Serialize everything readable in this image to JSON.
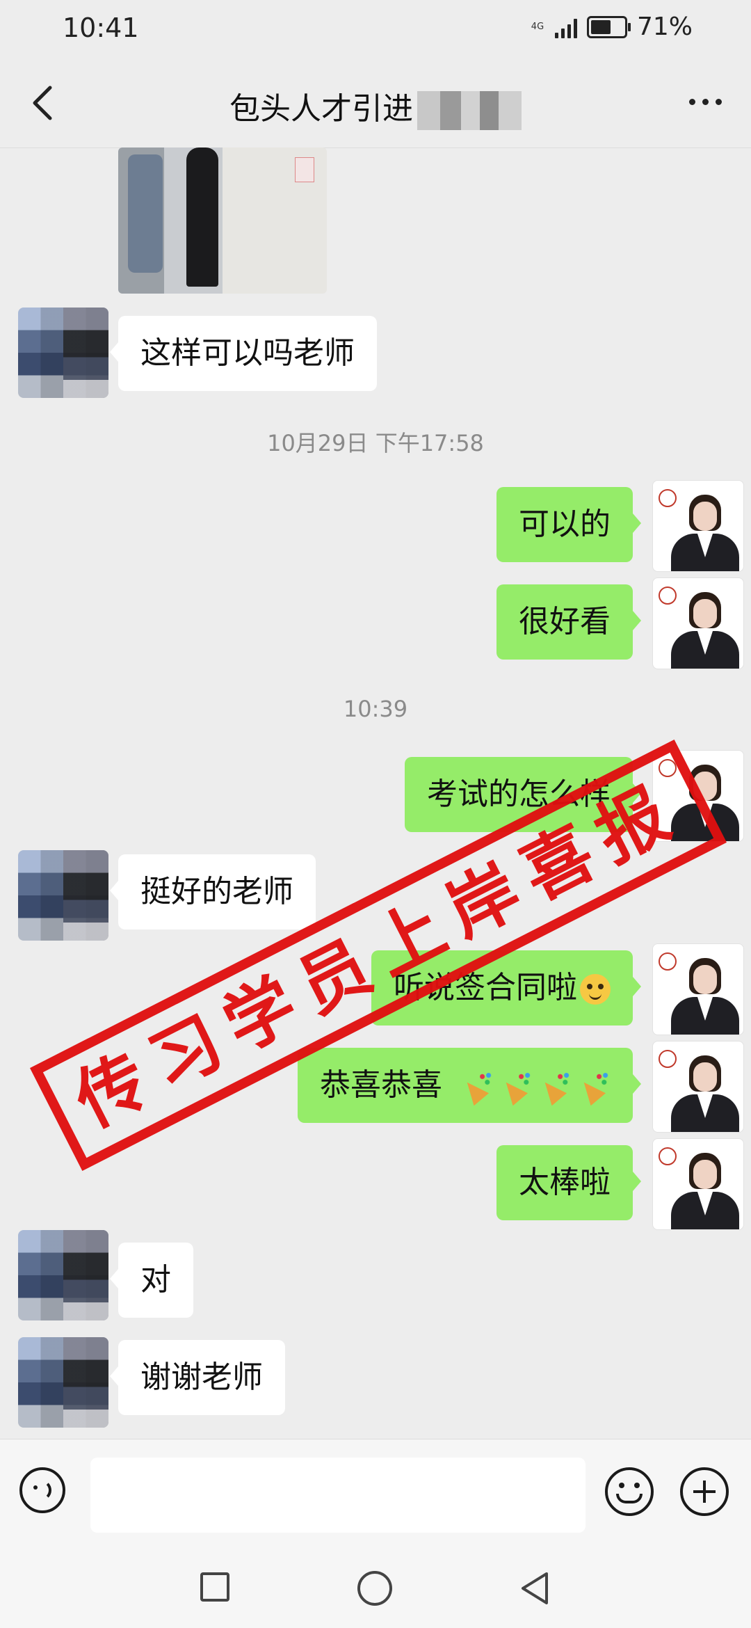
{
  "status_bar": {
    "time": "10:41",
    "network": "4G",
    "battery_percent": "71%",
    "battery_level": 0.71
  },
  "header": {
    "title": "包头人才引进"
  },
  "messages": [
    {
      "from": "customer",
      "text": "这样可以吗老师"
    },
    {
      "type": "timestamp",
      "text": "10月29日 下午17:58"
    },
    {
      "from": "teacher",
      "text": "可以的"
    },
    {
      "from": "teacher",
      "text": "很好看"
    },
    {
      "type": "timestamp",
      "text": "10:39"
    },
    {
      "from": "teacher",
      "text": "考试的怎么样"
    },
    {
      "from": "customer",
      "text": "挺好的老师"
    },
    {
      "from": "teacher",
      "text": "听说签合同啦",
      "emoji": [
        "smiling-face-emoji"
      ]
    },
    {
      "from": "teacher",
      "text": "恭喜恭喜",
      "emoji": [
        "party-popper-emoji",
        "party-popper-emoji",
        "party-popper-emoji",
        "party-popper-emoji"
      ]
    },
    {
      "from": "teacher",
      "text": "太棒啦"
    },
    {
      "from": "customer",
      "text": "对"
    },
    {
      "from": "customer",
      "text": "谢谢老师"
    }
  ],
  "overlay_stamp": {
    "text": "传习学员上岸喜报",
    "color": "#e01010"
  },
  "input_bar": {
    "placeholder": ""
  },
  "colors": {
    "outgoing_bubble": "#95ec69",
    "incoming_bubble": "#ffffff",
    "background": "#ededed"
  },
  "icons": [
    "back-icon",
    "more-icon",
    "voice-icon",
    "emoji-icon",
    "plus-icon",
    "nav-recent-icon",
    "nav-home-icon",
    "nav-back-icon"
  ]
}
